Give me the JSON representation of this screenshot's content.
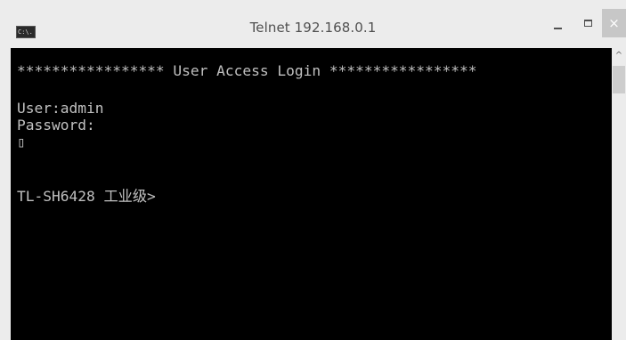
{
  "window": {
    "title": "Telnet 192.168.0.1",
    "icon_label": "C:\\.",
    "controls": {
      "minimize_icon": "minimize-icon",
      "maximize_icon": "maximize-icon",
      "close_icon": "close-icon",
      "close_glyph": "×"
    }
  },
  "console": {
    "lines": [
      "***************** User Access Login *****************",
      "",
      "User:admin",
      "Password:",
      "▯",
      "",
      "",
      "TL-SH6428 工业级>"
    ]
  },
  "scrollbar": {
    "up_arrow": "^"
  }
}
